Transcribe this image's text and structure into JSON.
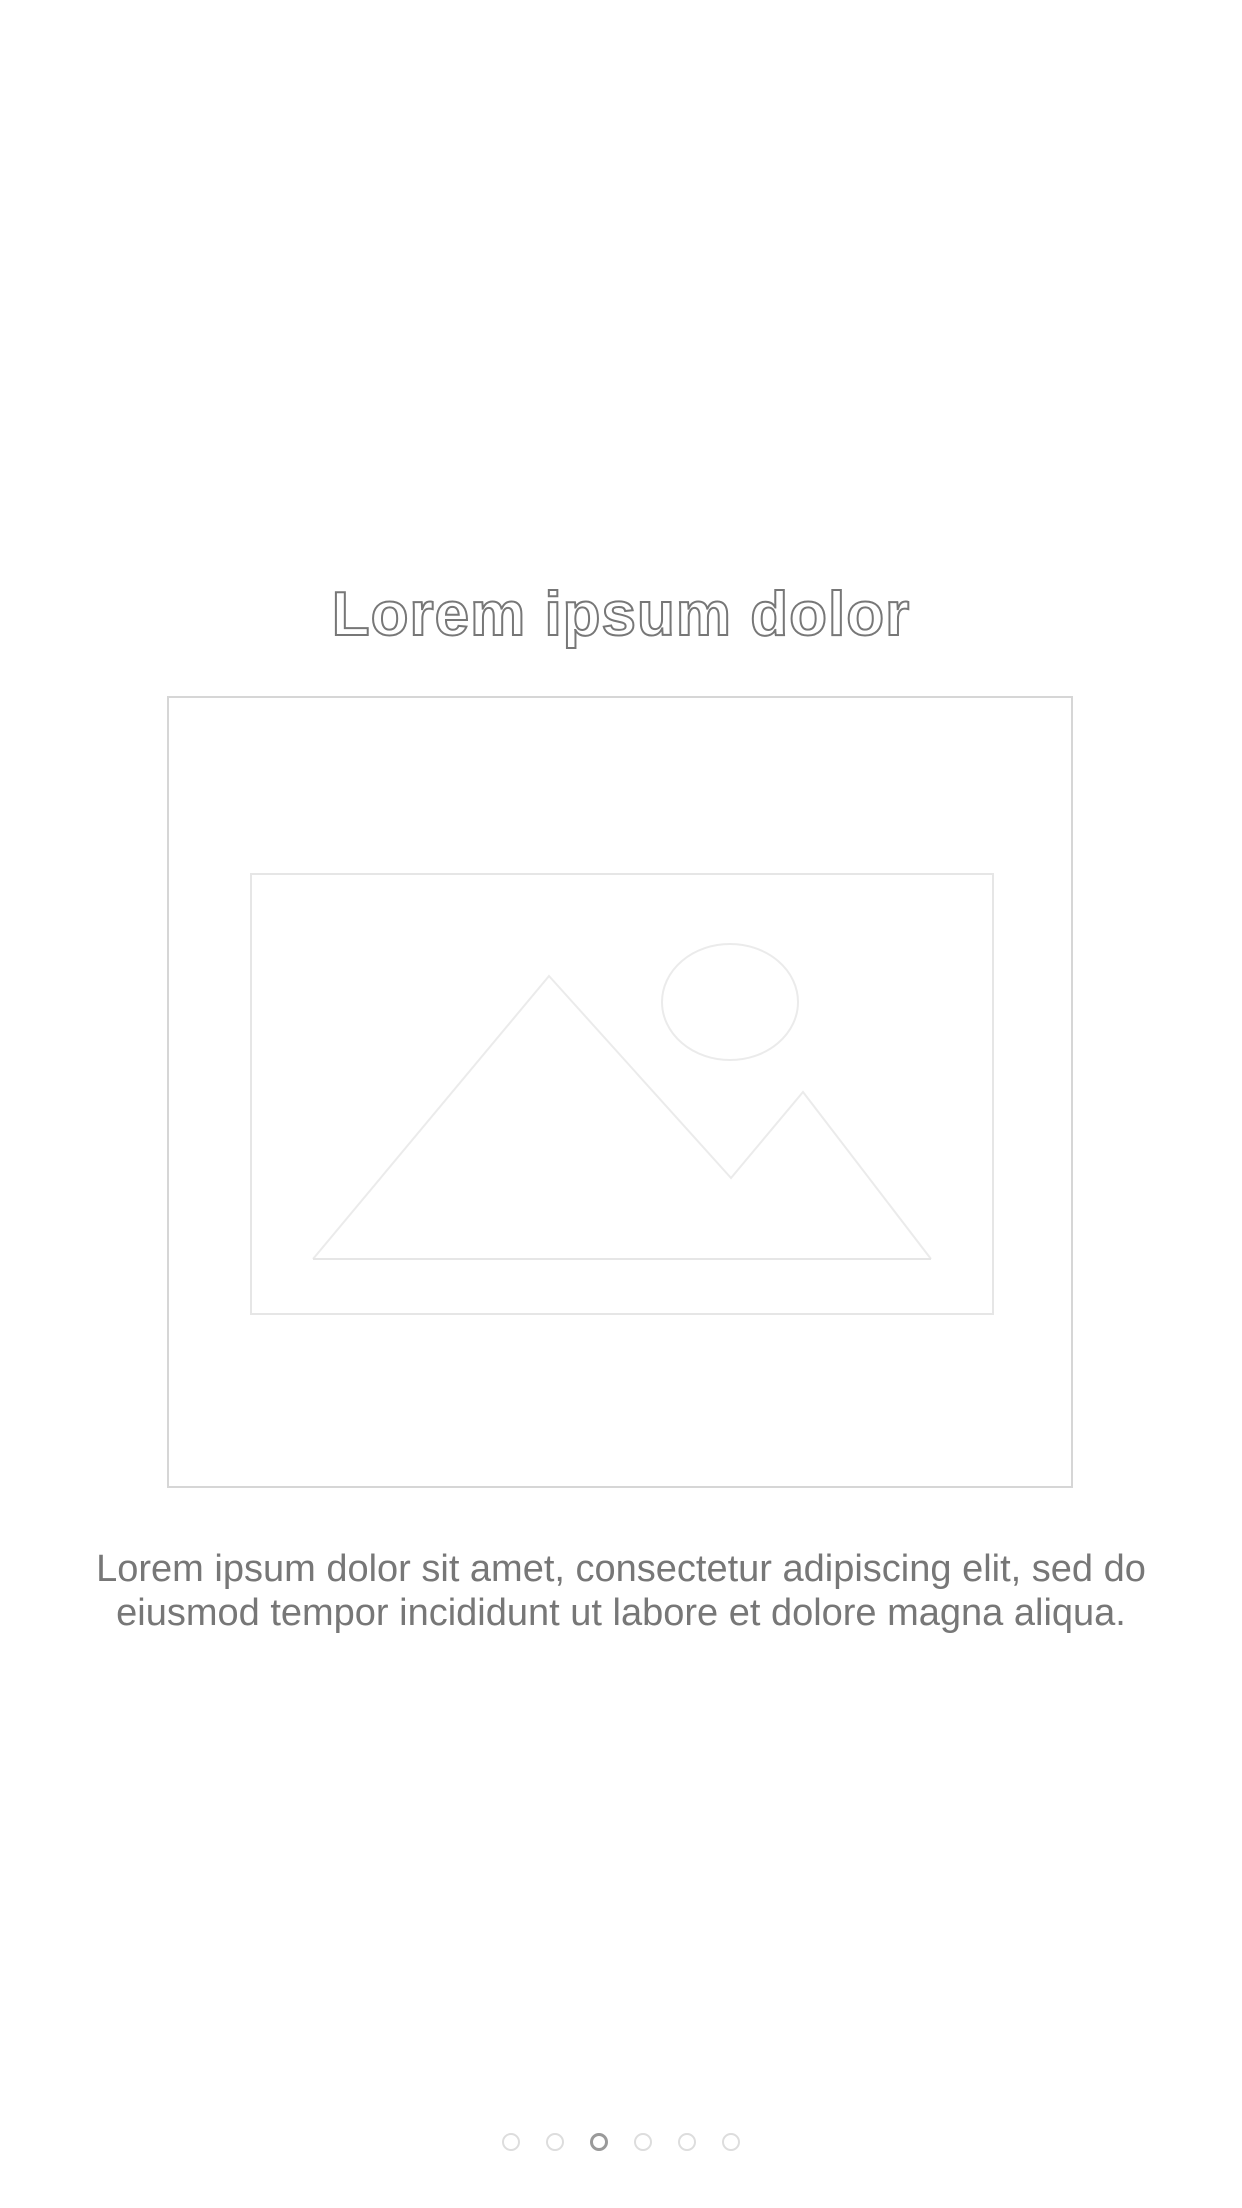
{
  "onboarding": {
    "title": "Lorem ipsum dolor",
    "image": {
      "icon": "image-placeholder-icon"
    },
    "description": "Lorem ipsum dolor sit amet, consectetur adipiscing elit, sed do eiusmod tempor incididunt ut labore et dolore magna aliqua."
  },
  "pager": {
    "total_pages": 6,
    "current_page": 3
  },
  "colors": {
    "title_outline": "#777777",
    "text": "#777777",
    "frame_border": "#d6d6d6",
    "dot_inactive": "#dddddd",
    "dot_active": "#9a9a9a"
  }
}
